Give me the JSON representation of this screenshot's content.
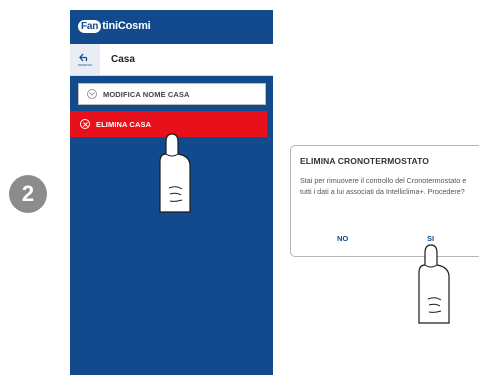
{
  "step": {
    "number": "2"
  },
  "app": {
    "logo_text": "FantiniCosmi",
    "logo_badge": "Fan",
    "logo_rest": "tiniCosmi",
    "back_label": "INDIETRO",
    "title": "Casa"
  },
  "menu": {
    "modify_label": "MODIFICA NOME CASA",
    "delete_label": "ELIMINA CASA"
  },
  "dialog": {
    "title": "ELIMINA CRONOTERMOSTATO",
    "body": "Stai per rimuovere il controllo del Cronotermostato e tutti i dati a lui associati da Intelliclima+. Procedere?",
    "no_label": "NO",
    "yes_label": "SI"
  },
  "colors": {
    "brand_blue": "#124a8d",
    "delete_red": "#e8101b",
    "badge_grey": "#8c8c8c"
  },
  "icons": [
    "back-arrow-icon",
    "chevron-down-icon",
    "close-circle-icon",
    "tap-hand-icon"
  ]
}
